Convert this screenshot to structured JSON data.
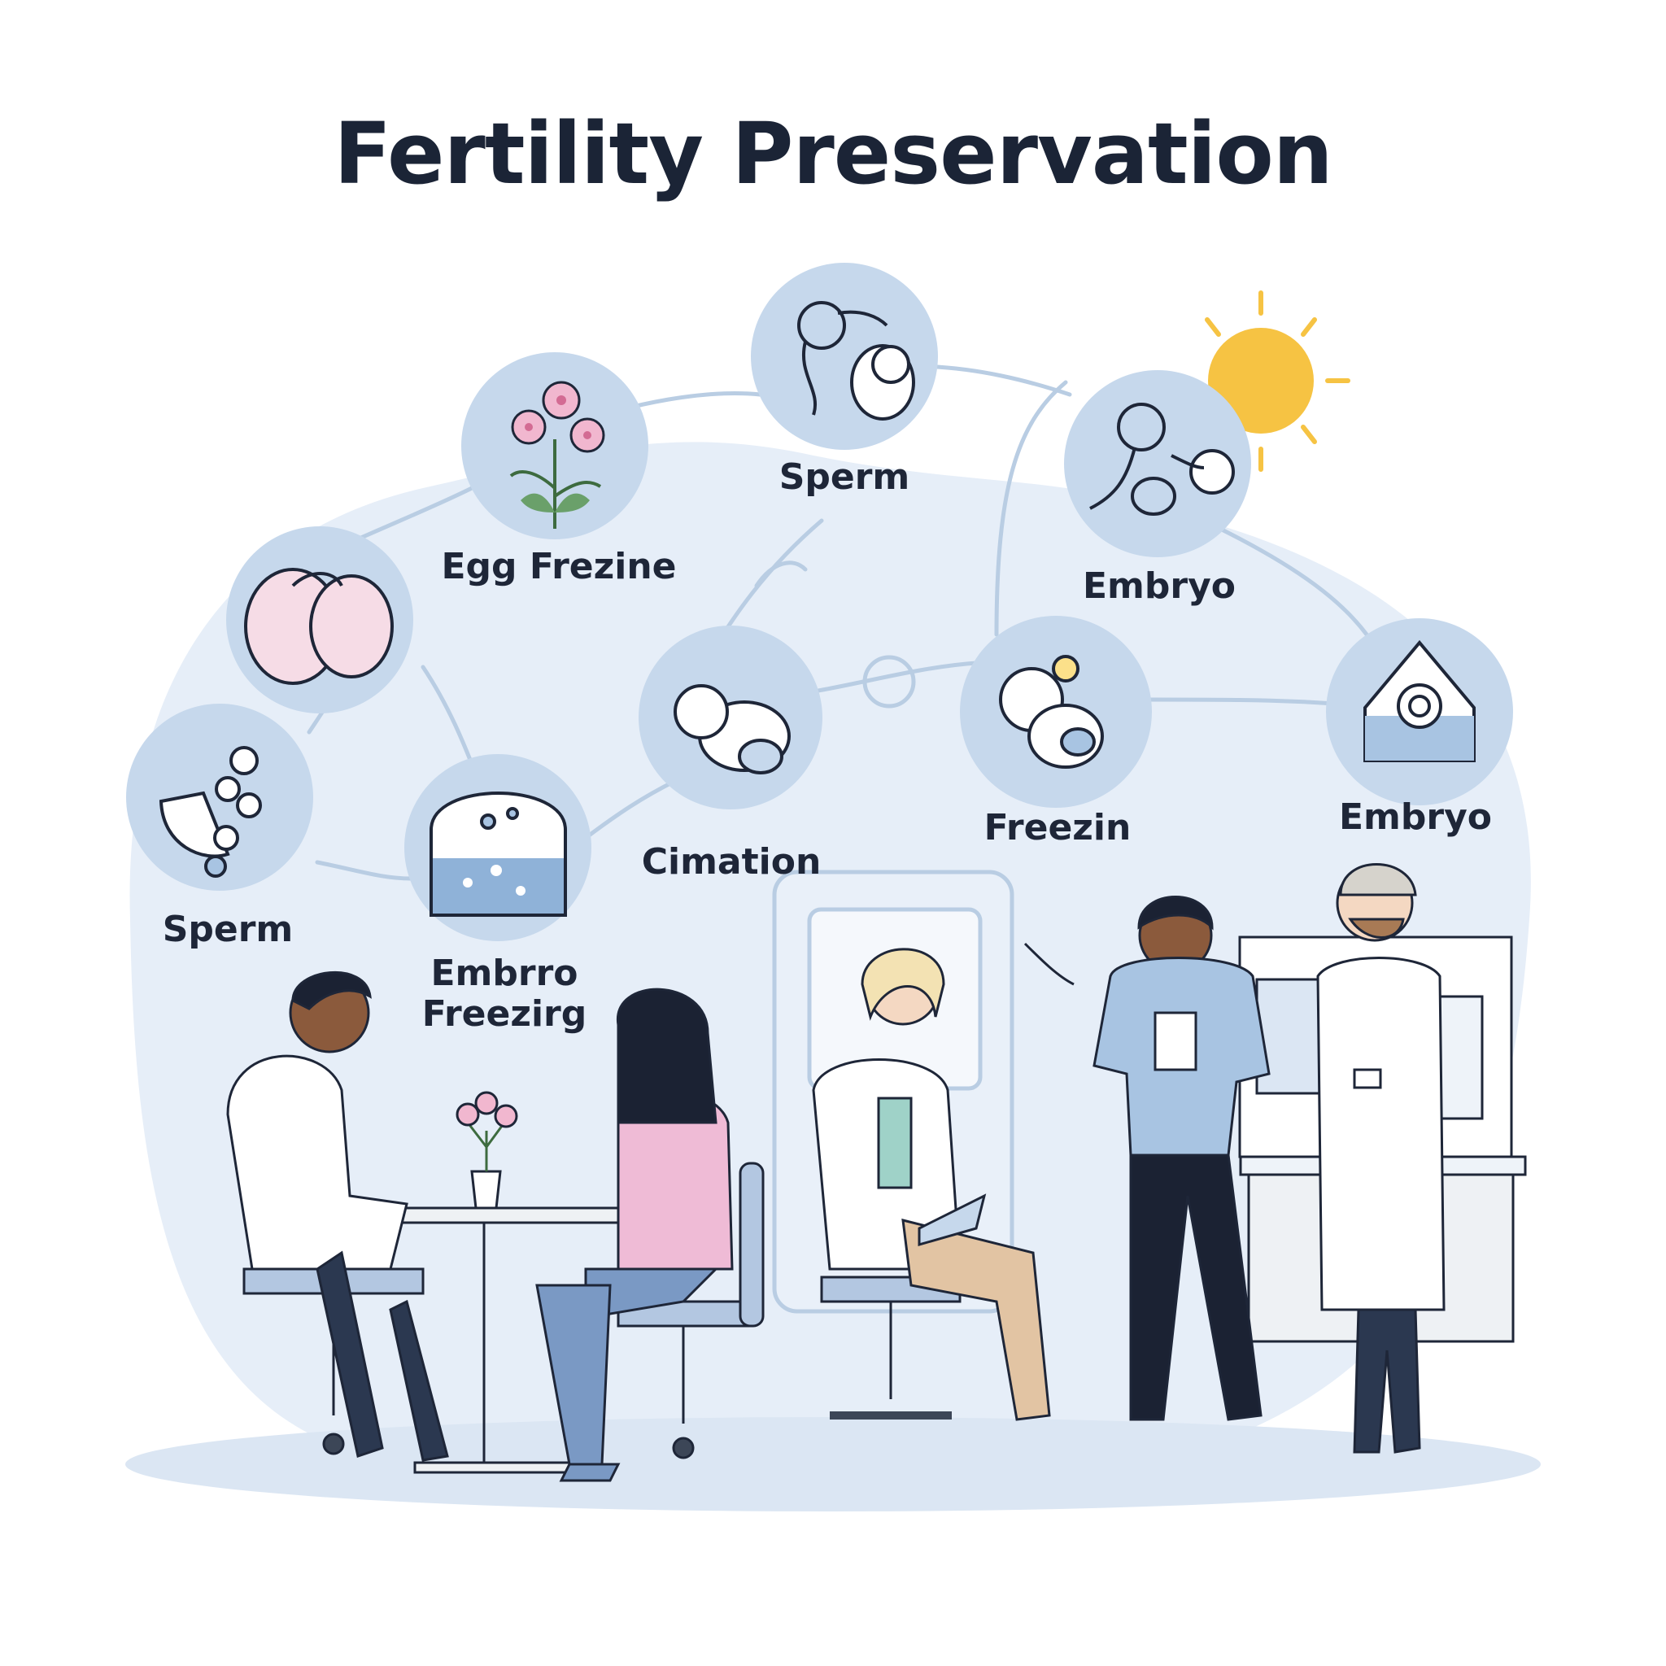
{
  "title": "Fertility Preservation",
  "colors": {
    "background": "#ffffff",
    "blob": "#e6eef8",
    "node_fill": "#c6d8ec",
    "node_ring": "#dbe6f3",
    "connector": "#b9cde3",
    "sun": "#f6c343",
    "ink": "#1e2638"
  },
  "nodes": [
    {
      "id": "sperm-top",
      "label": "Sperm",
      "icon": "sperm-baby-icon"
    },
    {
      "id": "egg-freezing",
      "label": "Egg Frezine",
      "icon": "flower-icon"
    },
    {
      "id": "embryo-top-right",
      "label": "Embryo",
      "icon": "embryo-cells-icon"
    },
    {
      "id": "egg-pink",
      "label": "",
      "icon": "egg-icon"
    },
    {
      "id": "cimation",
      "label": "Cimation",
      "icon": "fetus-icon"
    },
    {
      "id": "freezing",
      "label": "Freezin",
      "icon": "freezing-fetus-icon"
    },
    {
      "id": "embryo-right",
      "label": "Embryo",
      "icon": "incubator-icon"
    },
    {
      "id": "sperm-left",
      "label": "Sperm",
      "icon": "cracked-egg-icon"
    },
    {
      "id": "embryo-freezing",
      "label": "Embrro\nFreezirg",
      "icon": "freezing-jar-icon"
    }
  ],
  "people": [
    {
      "id": "doctor-seated-left",
      "icon": "doctor-seated-icon"
    },
    {
      "id": "patient-seated",
      "icon": "patient-seated-icon"
    },
    {
      "id": "doctor-seated-tablet",
      "icon": "doctor-tablet-icon"
    },
    {
      "id": "nurse-standing",
      "icon": "nurse-standing-icon"
    },
    {
      "id": "doctor-standing",
      "icon": "doctor-standing-icon"
    }
  ]
}
